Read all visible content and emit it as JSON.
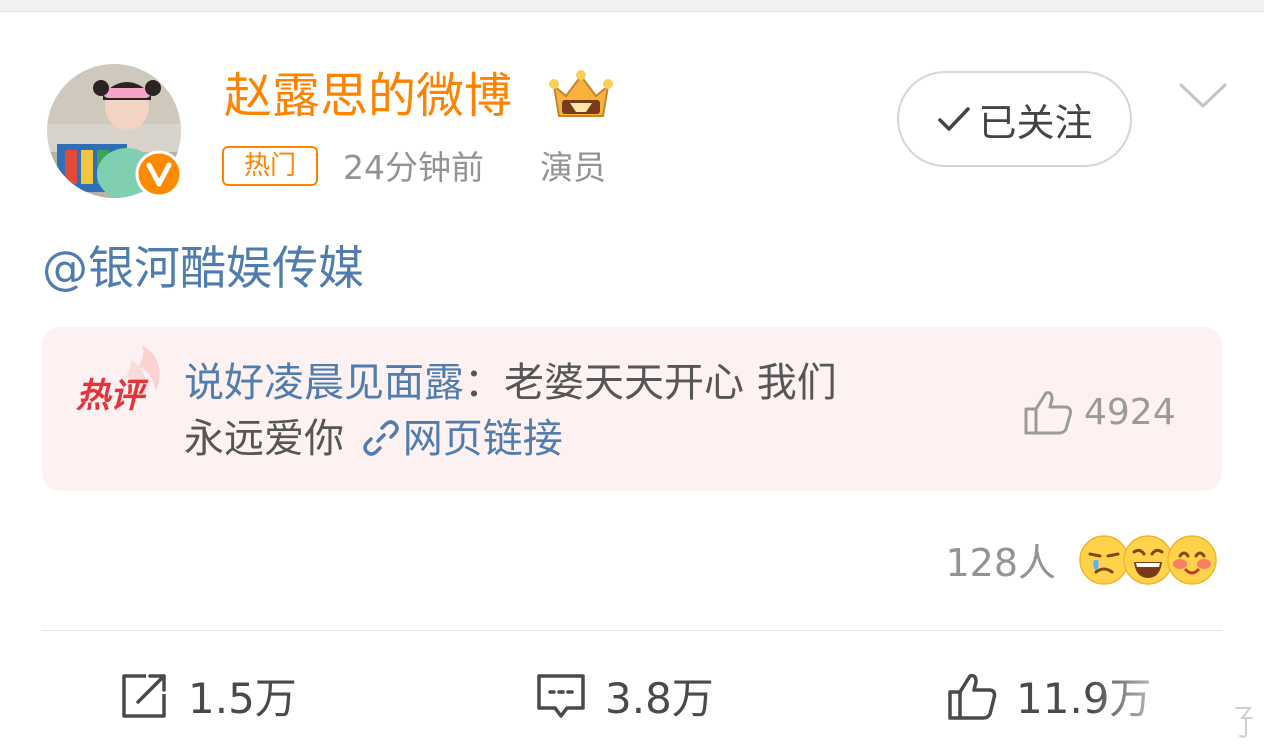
{
  "post": {
    "username": "赵露思的微博",
    "badge": "热门",
    "time": "24分钟前",
    "tag": "演员",
    "follow_label": "已关注",
    "mention": "@银河酷娱传媒"
  },
  "hot_comment": {
    "badge_label": "热评",
    "author": "说好凌晨见面露",
    "separator": "：",
    "text_line1": "老婆天天开心 我们",
    "text_line2": "永远爱你",
    "link_label": "网页链接",
    "likes": "4924"
  },
  "reactions": {
    "count": "128人",
    "emojis": [
      "sad-face-icon",
      "laughing-face-icon",
      "blushing-face-icon"
    ]
  },
  "actions": {
    "repost": "1.5万",
    "comment": "3.8万",
    "like": "11.9万"
  },
  "colors": {
    "accent_orange": "#ff8200",
    "link_blue": "#507daf",
    "hot_comment_bg": "#fdf1f1",
    "meta_gray": "#939393"
  }
}
